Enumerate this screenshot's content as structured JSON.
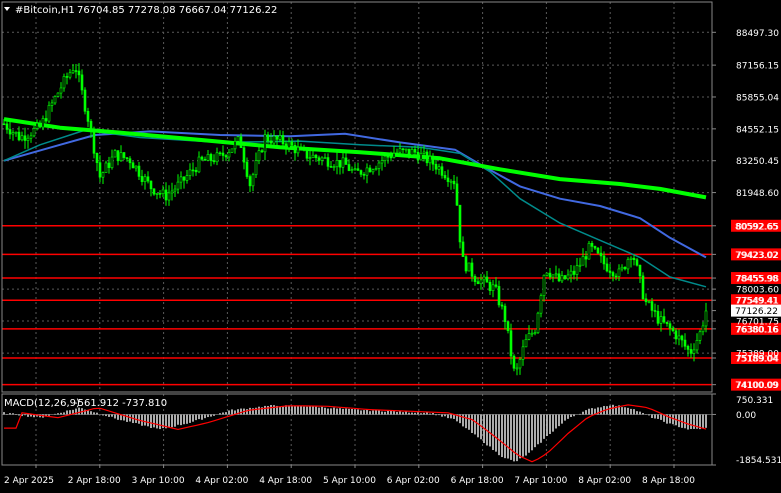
{
  "header": {
    "symbol": "#Bitcoin,H1",
    "ohlc": "76704.85 77278.08 76667.04 77126.22"
  },
  "price_axis": {
    "ticks": [
      "88497.30",
      "87156.15",
      "85855.04",
      "84552.15",
      "83250.45",
      "81948.60",
      "80592.65",
      "79423.02",
      "78455.98",
      "78003.60",
      "77549.41",
      "77126.22",
      "76701.75",
      "76380.16",
      "75389.00",
      "75189.04",
      "74100.09"
    ]
  },
  "level_labels": [
    "80592.65",
    "79423.02",
    "78455.98",
    "77549.41",
    "76380.16",
    "75189.04",
    "74100.09"
  ],
  "current_price_label": "77126.22",
  "indicator": {
    "name": "MACD(12,26,9)",
    "values": "-561.912 -737.810",
    "axis_labels": [
      "750.331",
      "0.00",
      "-1854.531"
    ]
  },
  "time_axis": {
    "labels": [
      "2 Apr 2025",
      "2 Apr 18:00",
      "3 Apr 10:00",
      "4 Apr 02:00",
      "4 Apr 18:00",
      "5 Apr 10:00",
      "6 Apr 02:00",
      "6 Apr 18:00",
      "7 Apr 10:00",
      "8 Apr 02:00",
      "8 Apr 18:00"
    ]
  },
  "colors": {
    "background": "#000000",
    "candle": "#00ff00",
    "ma_fast": "#00ff00",
    "ma_mid": "#4169e1",
    "ma_slow": "#008b8b",
    "level_line": "#ff0000",
    "level_label_bg": "#ff0000",
    "price_label_bg": "#ffffff",
    "macd_histogram": "#c0c0c0",
    "macd_signal": "#ff0000",
    "grid": "#5a5a5a",
    "text": "#ffffff"
  },
  "chart_data": {
    "type": "candlestick",
    "title": "#Bitcoin,H1",
    "ylim": [
      73800,
      89000
    ],
    "series": [
      {
        "name": "MACD(12,26,9)",
        "type": "histogram",
        "ylim": [
          -1854.531,
          750.331
        ]
      }
    ]
  }
}
